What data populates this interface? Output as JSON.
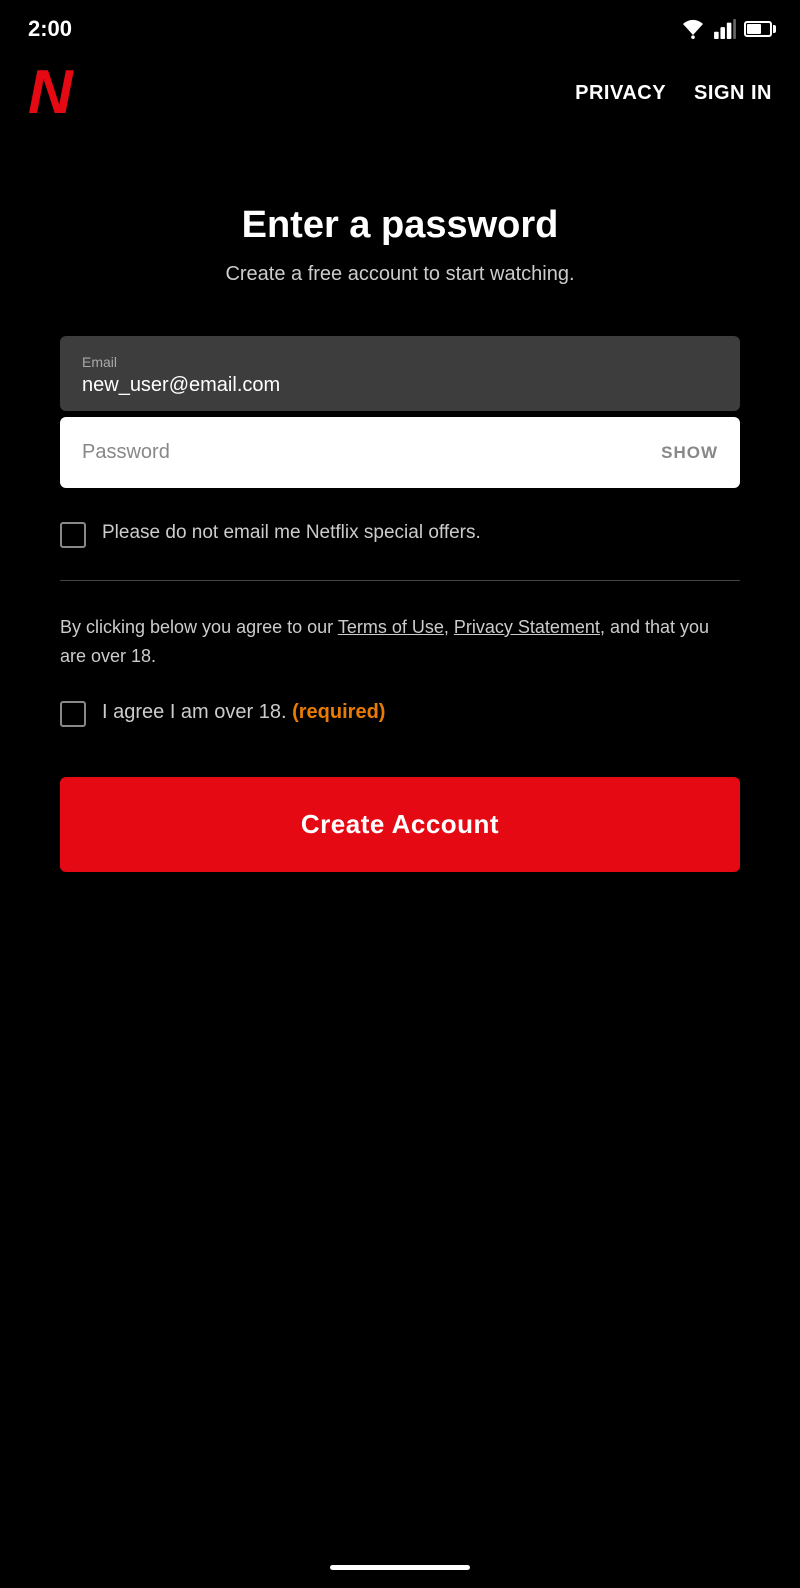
{
  "statusBar": {
    "time": "2:00"
  },
  "header": {
    "logoText": "N",
    "navLinks": [
      {
        "id": "privacy",
        "label": "PRIVACY"
      },
      {
        "id": "signin",
        "label": "SIGN IN"
      }
    ]
  },
  "page": {
    "title": "Enter a password",
    "subtitle": "Create a free account to start watching.",
    "emailField": {
      "label": "Email",
      "value": "new_user@email.com"
    },
    "passwordField": {
      "placeholder": "Password",
      "showLabel": "SHOW"
    },
    "checkbox1": {
      "label": "Please do not email me Netflix special offers."
    },
    "termsText": "By clicking below you agree to our ",
    "termsLink1": "Terms of Use",
    "termsComma": ", ",
    "termsLink2": "Privacy Statement",
    "termsEnd": ", and that you are over 18.",
    "checkbox2": {
      "label": "I agree I am over 18.",
      "requiredText": "(required)"
    },
    "createAccountButton": "Create Account"
  }
}
